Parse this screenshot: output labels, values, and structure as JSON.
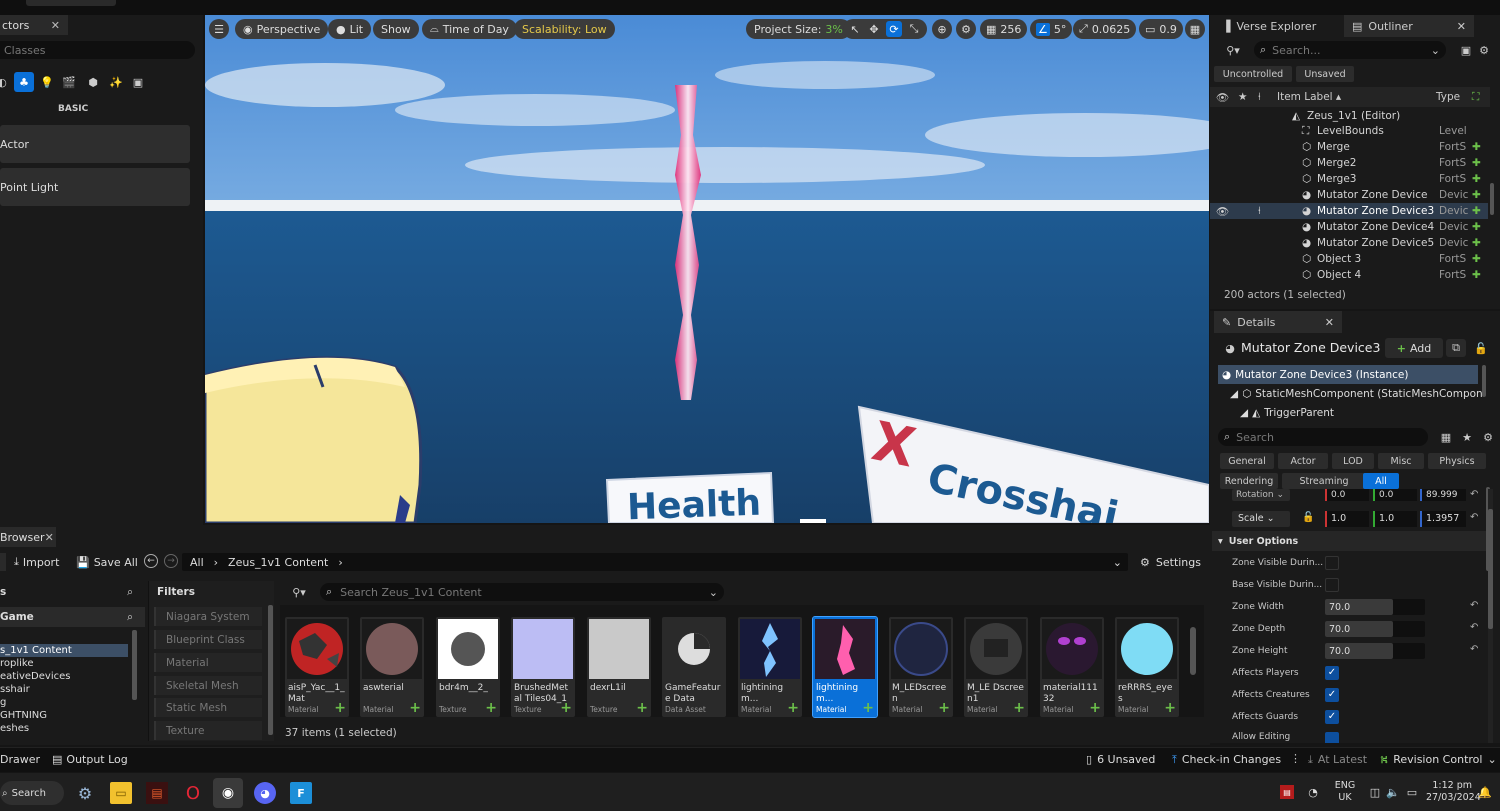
{
  "colors": {
    "accent": "#0a70d8",
    "green": "#6cc04a",
    "selection": "#0d4f9e",
    "scalability": "#e5c94a"
  },
  "place_actors": {
    "tab_label": "ctors",
    "search_placeholder": "Classes",
    "section_label": "BASIC",
    "items": [
      {
        "label": "Actor"
      },
      {
        "label": "Point Light"
      }
    ]
  },
  "viewport": {
    "perspective": "Perspective",
    "lit": "Lit",
    "show": "Show",
    "time_of_day": "Time of Day",
    "scalability": "Scalability: Low",
    "project_size_label": "Project Size:",
    "project_size_value": "3%",
    "grid": "256",
    "angle": "5°",
    "scale": "0.0625",
    "camera_speed": "0.9",
    "sign_health": "Health",
    "sign_x": "X",
    "sign_crosshair": "Crosshai"
  },
  "outliner": {
    "tab_verse": "Verse Explorer",
    "tab_outliner": "Outliner",
    "search_placeholder": "Search...",
    "filter_uncontrolled": "Uncontrolled",
    "filter_unsaved": "Unsaved",
    "col_label": "Item Label ▴",
    "col_type": "Type",
    "root": "Zeus_1v1 (Editor)",
    "items": [
      {
        "label": "LevelBounds",
        "type": "Level"
      },
      {
        "label": "Merge",
        "type": "FortS"
      },
      {
        "label": "Merge2",
        "type": "FortS"
      },
      {
        "label": "Merge3",
        "type": "FortS"
      },
      {
        "label": "Mutator Zone Device",
        "type": "Devic"
      },
      {
        "label": "Mutator Zone Device3",
        "type": "Devic"
      },
      {
        "label": "Mutator Zone Device4",
        "type": "Devic"
      },
      {
        "label": "Mutator Zone Device5",
        "type": "Devic"
      },
      {
        "label": "Object 3",
        "type": "FortS"
      },
      {
        "label": "Object 4",
        "type": "FortS"
      }
    ],
    "status": "200 actors (1 selected)"
  },
  "details": {
    "tab_label": "Details",
    "object_name": "Mutator Zone Device3",
    "add_label": "Add",
    "tree": [
      "Mutator Zone Device3 (Instance)",
      "StaticMeshComponent (StaticMeshComponent",
      "TriggerParent"
    ],
    "search_placeholder": "Search",
    "filters_row1": [
      "General",
      "Actor",
      "LOD",
      "Misc",
      "Physics"
    ],
    "filters_row2": [
      "Rendering",
      "Streaming",
      "All"
    ],
    "rotation_label": "Rotation",
    "rotation": [
      "0.0",
      "0.0",
      "89.999"
    ],
    "scale_label": "Scale",
    "scale": [
      "1.0",
      "1.0",
      "1.3957"
    ],
    "section_user_options": "User Options",
    "props": [
      {
        "label": "Zone Visible Durin...",
        "kind": "check",
        "checked": false
      },
      {
        "label": "Base Visible Durin...",
        "kind": "check",
        "checked": false
      },
      {
        "label": "Zone Width",
        "kind": "number",
        "value": "70.0"
      },
      {
        "label": "Zone Depth",
        "kind": "number",
        "value": "70.0"
      },
      {
        "label": "Zone Height",
        "kind": "number",
        "value": "70.0"
      },
      {
        "label": "Affects Players",
        "kind": "check",
        "checked": true
      },
      {
        "label": "Affects Creatures",
        "kind": "check",
        "checked": true
      },
      {
        "label": "Affects Guards",
        "kind": "check",
        "checked": true
      },
      {
        "label": "Allow Editing",
        "kind": "check",
        "checked": true
      }
    ]
  },
  "content_browser": {
    "tab_label": "Browser",
    "import": "Import",
    "save_all": "Save All",
    "crumb_all": "All",
    "crumb_folder": "Zeus_1v1 Content",
    "settings": "Settings",
    "sources_header": "s",
    "game_header": "Game",
    "folders": [
      "s_1v1 Content",
      "roplike",
      "eativeDevices",
      "sshair",
      "g",
      "GHTNING",
      "eshes"
    ],
    "filters_header": "Filters",
    "filters": [
      "Niagara System",
      "Blueprint Class",
      "Material",
      "Skeletal Mesh",
      "Static Mesh",
      "Texture"
    ],
    "search_placeholder": "Search Zeus_1v1 Content",
    "assets": [
      {
        "name": "aisP_Yac__1_ Mat",
        "type": "Material"
      },
      {
        "name": "aswterial",
        "type": "Material"
      },
      {
        "name": "bdr4m__2_",
        "type": "Texture"
      },
      {
        "name": "BrushedMetal Tiles04_1K_",
        "type": "Texture"
      },
      {
        "name": "dexrL1il",
        "type": "Texture"
      },
      {
        "name": "GameFeature Data",
        "type": "Data Asset"
      },
      {
        "name": "lightiningm...",
        "type": "Material"
      },
      {
        "name": "lightiningm...",
        "type": "Material"
      },
      {
        "name": "M_LEDscreen",
        "type": "Material"
      },
      {
        "name": "M_LE Dscreen1",
        "type": "Material"
      },
      {
        "name": "material11132",
        "type": "Material"
      },
      {
        "name": "reRRRS_eyes",
        "type": "Material"
      }
    ],
    "status": "37 items (1 selected)"
  },
  "bottom_bar": {
    "drawer": "Drawer",
    "output_log": "Output Log",
    "unsaved": "6 Unsaved",
    "checkin": "Check-in Changes",
    "at_latest": "At Latest",
    "revision": "Revision Control"
  },
  "taskbar": {
    "search": "Search",
    "lang1": "ENG",
    "lang2": "UK",
    "time": "1:12 pm",
    "date": "27/03/2024"
  }
}
